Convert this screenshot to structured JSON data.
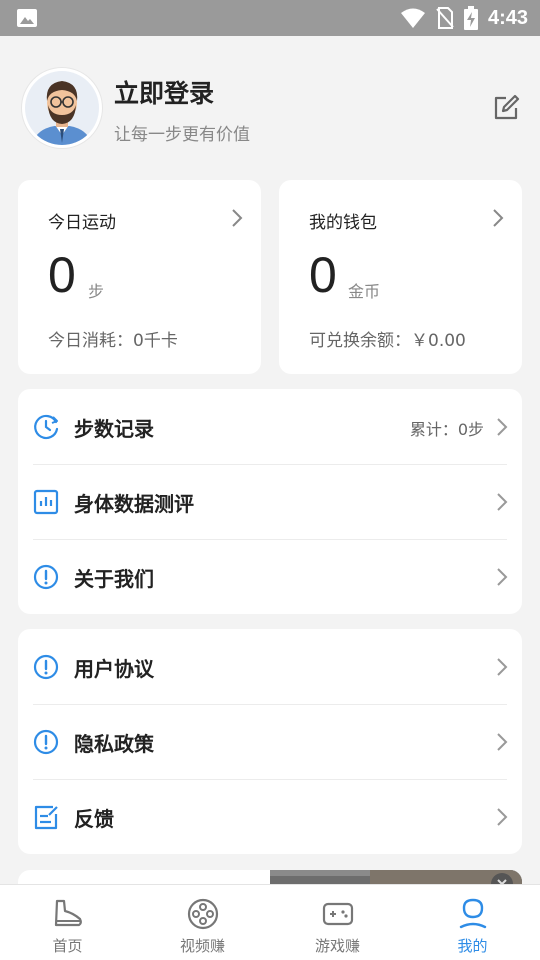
{
  "status_bar": {
    "time": "4:43",
    "icons": [
      "image-icon",
      "wifi-icon",
      "no-sim-icon",
      "battery-charging-icon"
    ]
  },
  "profile": {
    "title": "立即登录",
    "subtitle": "让每一步更有价值",
    "edit_icon": "edit-icon"
  },
  "stats": {
    "today": {
      "title": "今日运动",
      "value": "0",
      "unit": "步",
      "footer": "今日消耗：0千卡"
    },
    "wallet": {
      "title": "我的钱包",
      "value": "0",
      "unit": "金币",
      "footer": "可兑换余额：￥0.00"
    }
  },
  "menu_group_1": [
    {
      "label": "步数记录",
      "extra": "累计：0步",
      "icon": "clock-history-icon"
    },
    {
      "label": "身体数据测评",
      "extra": "",
      "icon": "bar-chart-icon"
    },
    {
      "label": "关于我们",
      "extra": "",
      "icon": "info-icon"
    }
  ],
  "menu_group_2": [
    {
      "label": "用户协议",
      "icon": "info-icon"
    },
    {
      "label": "隐私政策",
      "icon": "info-icon"
    },
    {
      "label": "反馈",
      "icon": "feedback-icon"
    }
  ],
  "tabs": [
    {
      "label": "首页",
      "icon": "shoe-icon",
      "active": false
    },
    {
      "label": "视频赚",
      "icon": "film-reel-icon",
      "active": false
    },
    {
      "label": "游戏赚",
      "icon": "gamepad-icon",
      "active": false
    },
    {
      "label": "我的",
      "icon": "user-icon",
      "active": true
    }
  ],
  "colors": {
    "accent": "#2e8ce6",
    "background": "#f3f3f3",
    "card": "#ffffff",
    "status_bar": "#9a9a9a"
  }
}
